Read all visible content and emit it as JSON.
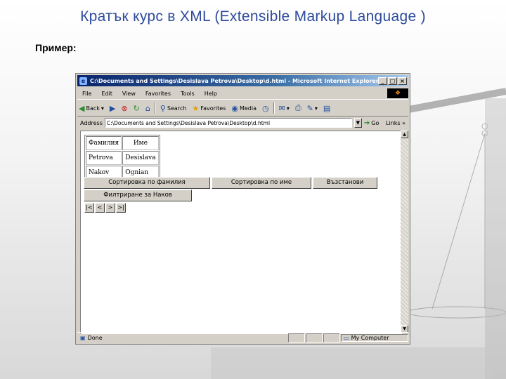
{
  "slide": {
    "title": "Кратък курс в XML (Extensible Markup Language )",
    "example_label": "Пример:"
  },
  "browser": {
    "window_title": "C:\\Documents and Settings\\Desislava Petrova\\Desktop\\d.html - Microsoft Internet Explorer",
    "window_buttons": {
      "minimize": "_",
      "maximize": "□",
      "close": "×"
    },
    "menu": [
      "File",
      "Edit",
      "View",
      "Favorites",
      "Tools",
      "Help"
    ],
    "toolbar": {
      "back": "Back",
      "search": "Search",
      "favorites": "Favorites",
      "media": "Media"
    },
    "address": {
      "label": "Address",
      "value": "C:\\Documents and Settings\\Desislava Petrova\\Desktop\\d.html",
      "go": "Go",
      "links": "Links »"
    },
    "status": {
      "text": "Done",
      "zone": "My Computer"
    }
  },
  "page": {
    "table": {
      "headers": [
        "Фамилия",
        "Име"
      ],
      "rows": [
        [
          "Petrova",
          "Desislava"
        ],
        [
          "Nakov",
          "Ognian"
        ]
      ]
    },
    "buttons": {
      "sort_name": "Сортировка по фамилия",
      "sort_first": "Сортировка по име",
      "restore": "Възстанови",
      "filter": "Филтриране за Наков"
    },
    "nav": {
      "first": "|<",
      "prev": "<",
      "next": ">",
      "last": ">|"
    }
  },
  "colors": {
    "title": "#2e4a9c",
    "titlebar": "#0a246a",
    "chrome": "#d4d0c8"
  }
}
